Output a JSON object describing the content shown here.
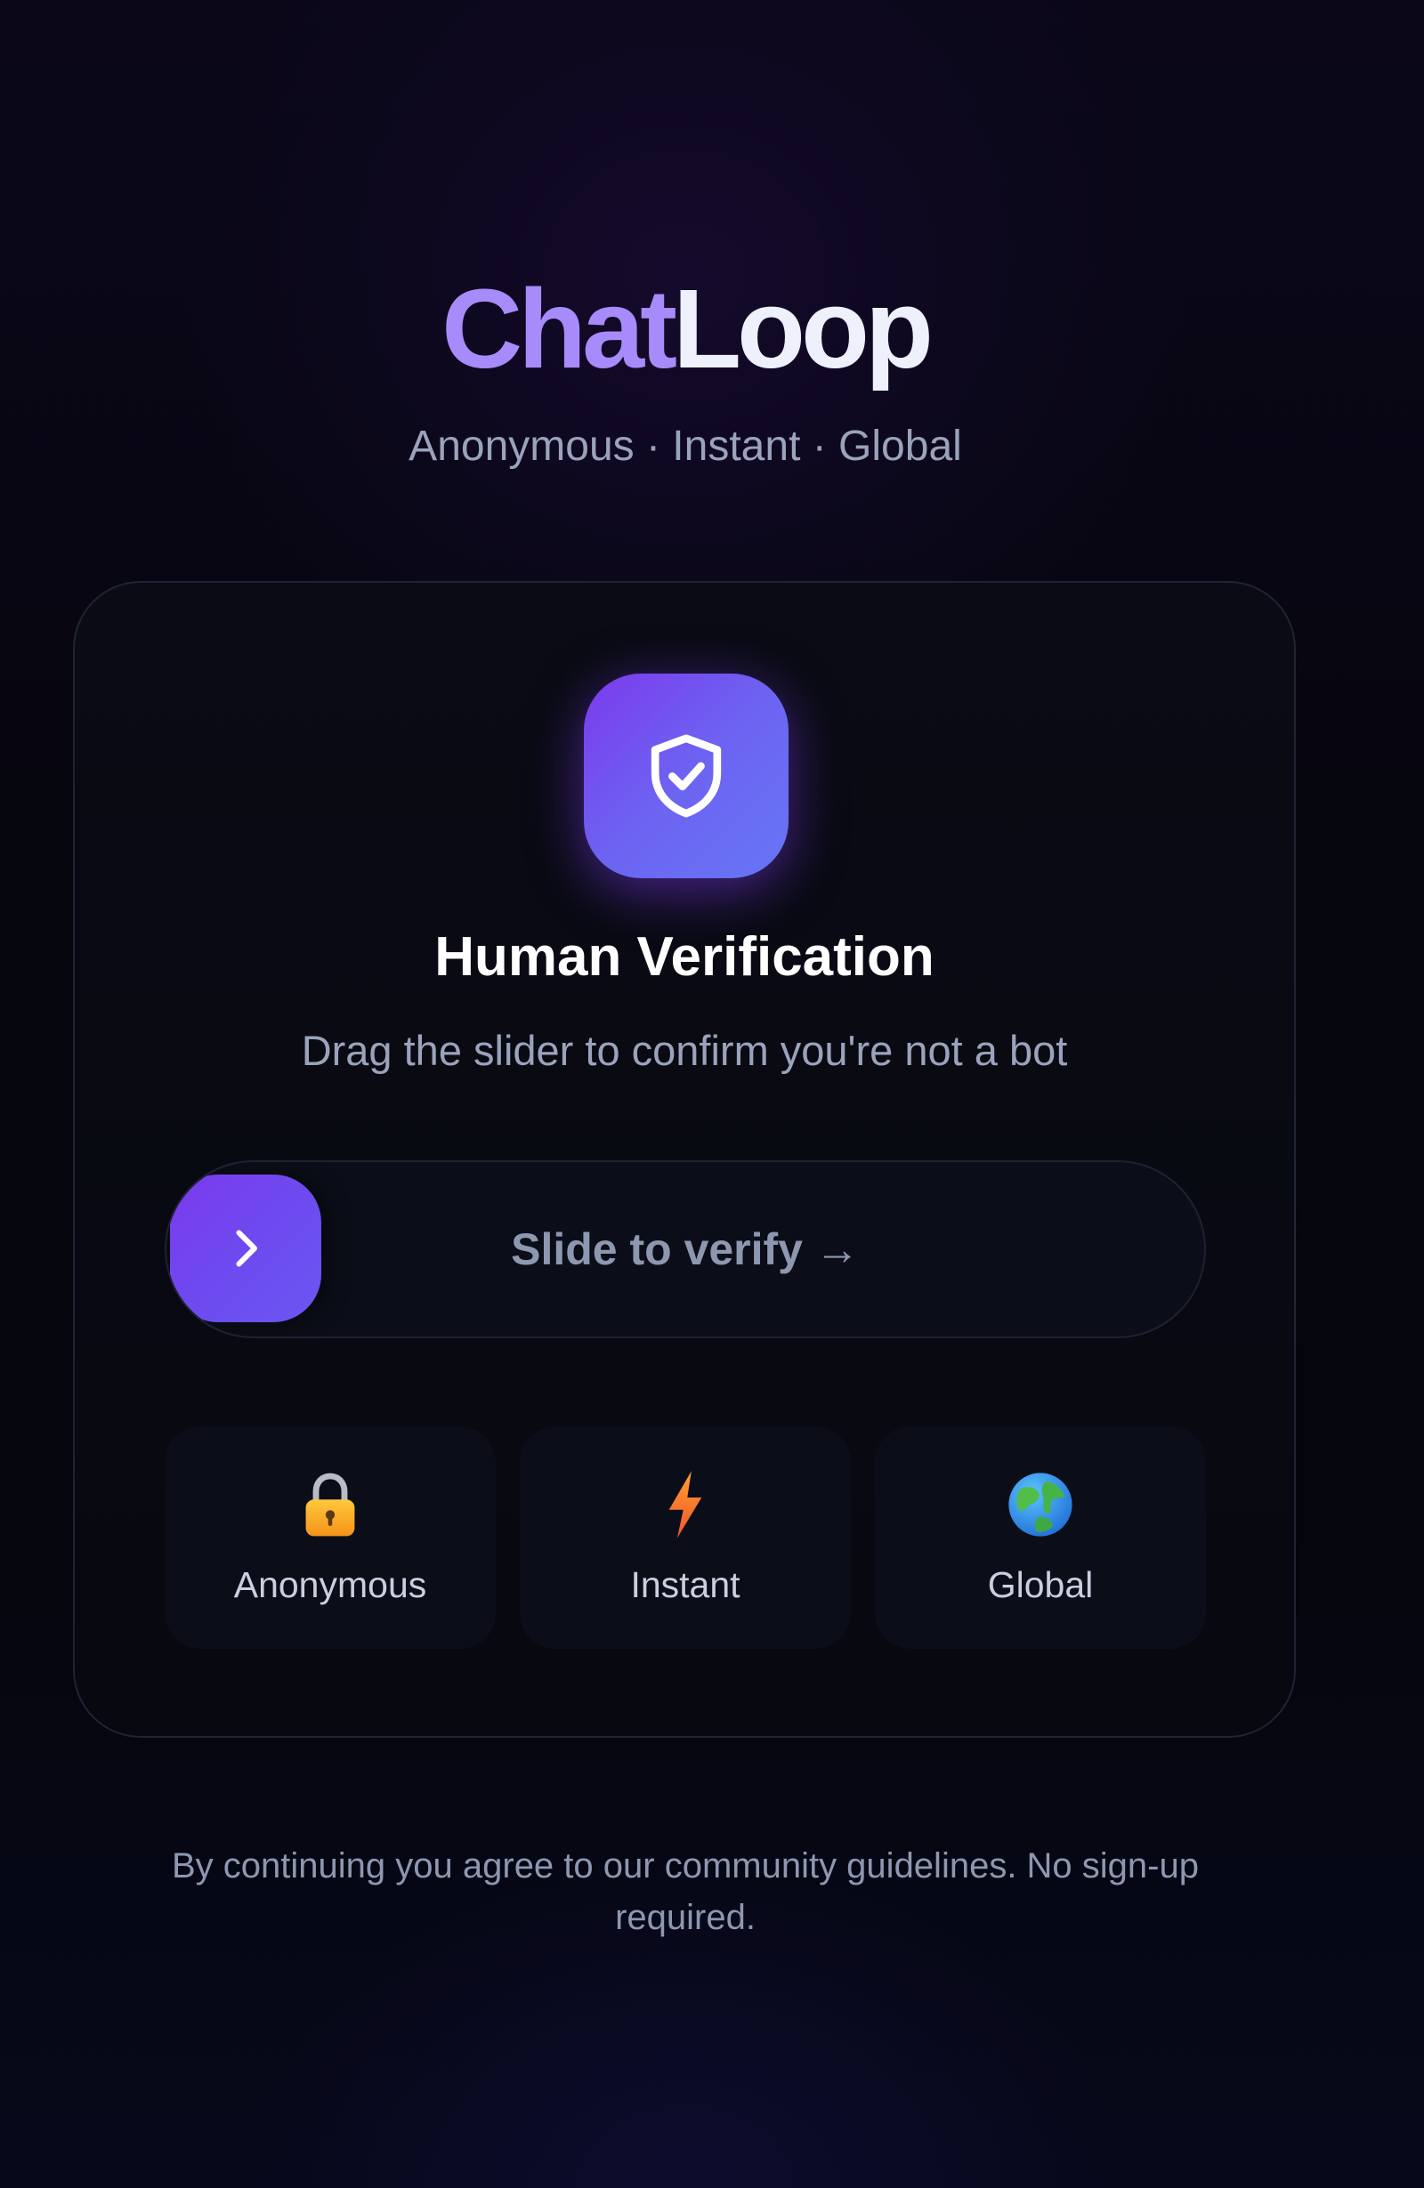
{
  "brand": {
    "name_part1": "Chat",
    "name_part2": "Loop",
    "tagline": "Anonymous · Instant · Global"
  },
  "verification": {
    "icon": "shield-check-icon",
    "title": "Human Verification",
    "subtitle": "Drag the slider to confirm you're not a bot",
    "slider_label": "Slide to verify →",
    "slider_handle_icon": "chevron-right-icon"
  },
  "features": [
    {
      "icon": "lock-icon",
      "label": "Anonymous"
    },
    {
      "icon": "lightning-icon",
      "label": "Instant"
    },
    {
      "icon": "globe-icon",
      "label": "Global"
    }
  ],
  "footer": {
    "text": "By continuing you agree to our community guidelines. No sign-up required."
  },
  "colors": {
    "accent": "#7c3aed",
    "accent_light": "#a78bfa",
    "background": "#05060c",
    "card": "#0a0b14",
    "muted_text": "#9aa3bb"
  }
}
